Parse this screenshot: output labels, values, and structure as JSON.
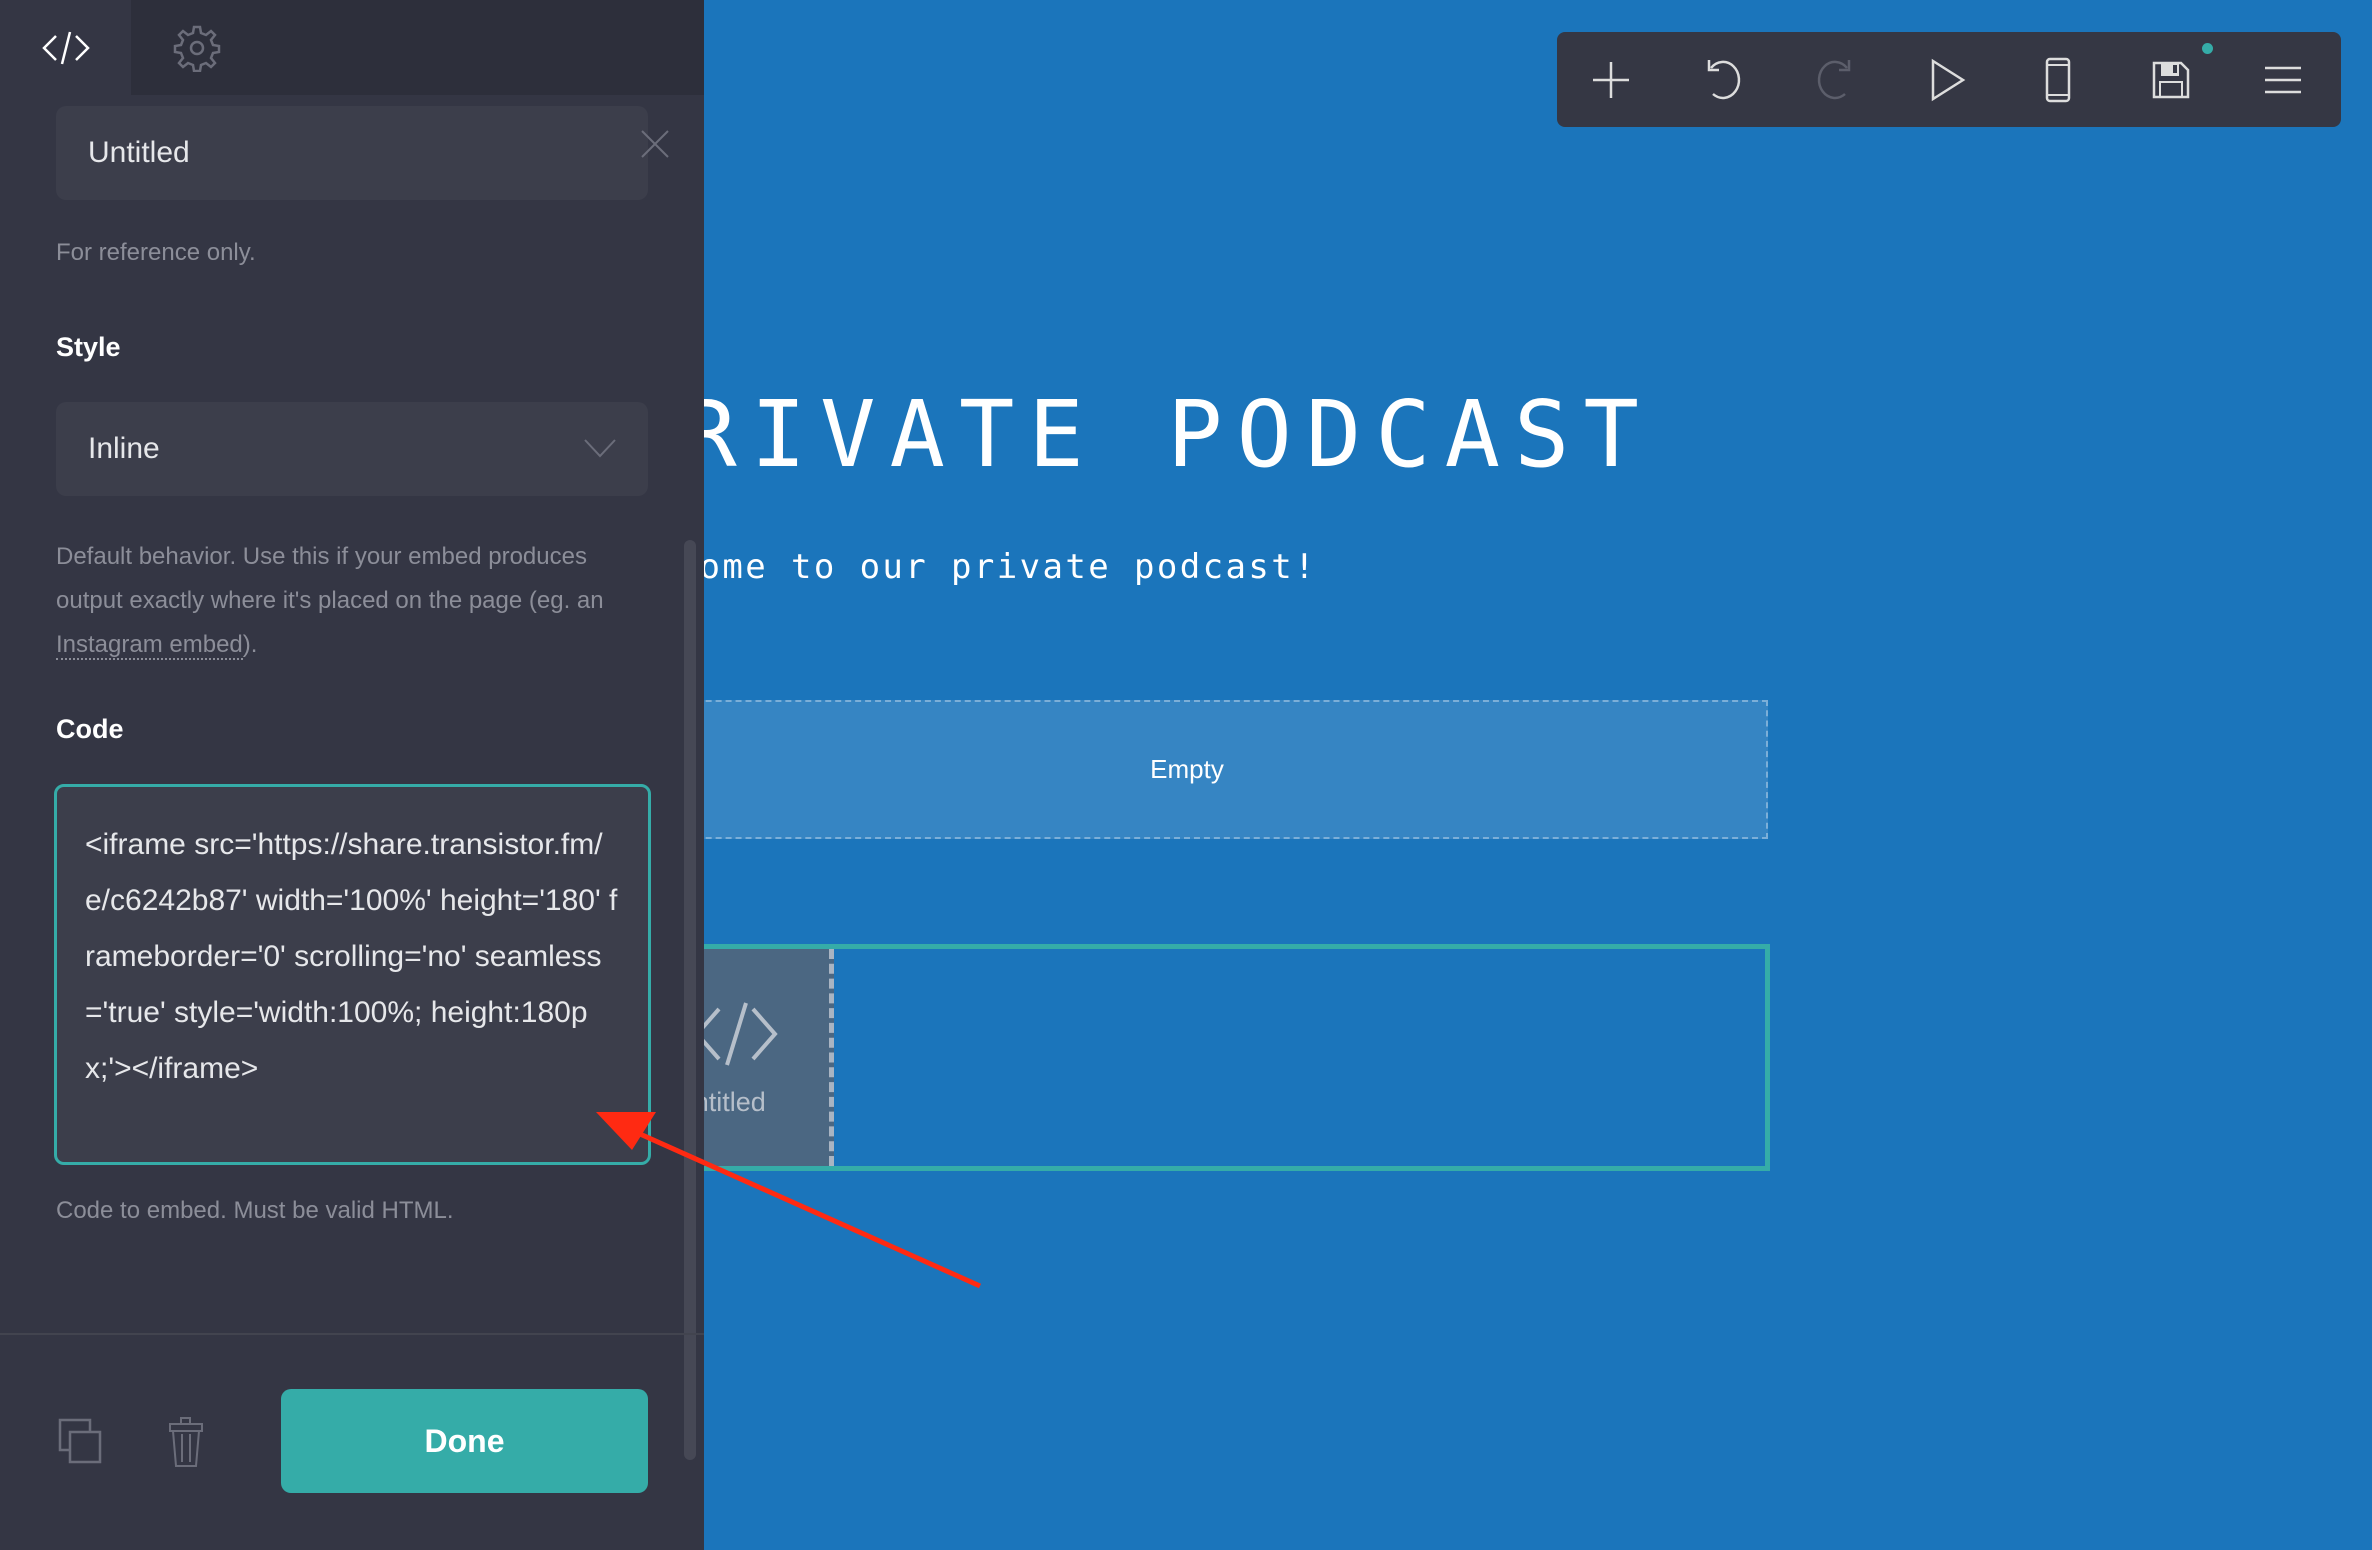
{
  "canvas": {
    "title": "PRIVATE PODCAST",
    "subtitle": "Welcome to our private podcast!",
    "empty_label": "Empty",
    "embed_label": "Untitled"
  },
  "toolbar": {
    "buttons": [
      "add-icon",
      "undo-icon",
      "redo-icon",
      "play-icon",
      "mobile-icon",
      "save-icon",
      "menu-icon"
    ],
    "unsaved_indicator_color": "#35aca8"
  },
  "panel": {
    "tabs": [
      "code-icon",
      "gear-icon"
    ],
    "name_value": "Untitled",
    "name_help": "For reference only.",
    "style_label": "Style",
    "style_value": "Inline",
    "style_help_pre": "Default behavior. Use this if your embed produces output exactly where it's placed on the page (eg. an ",
    "style_help_link": "Instagram embed",
    "style_help_post": ").",
    "code_label": "Code",
    "code_value": "<iframe src='https://share.transistor.fm/e/c6242b87' width='100%' height='180' frameborder='0' scrolling='no' seamless='true' style='width:100%; height:180px;'></iframe>",
    "code_help": "Code to embed. Must be valid HTML.",
    "done_label": "Done"
  },
  "colors": {
    "accent": "#35aca8",
    "canvas": "#1b75bb",
    "panel": "#343644",
    "annotation_arrow": "#ff2a12"
  }
}
